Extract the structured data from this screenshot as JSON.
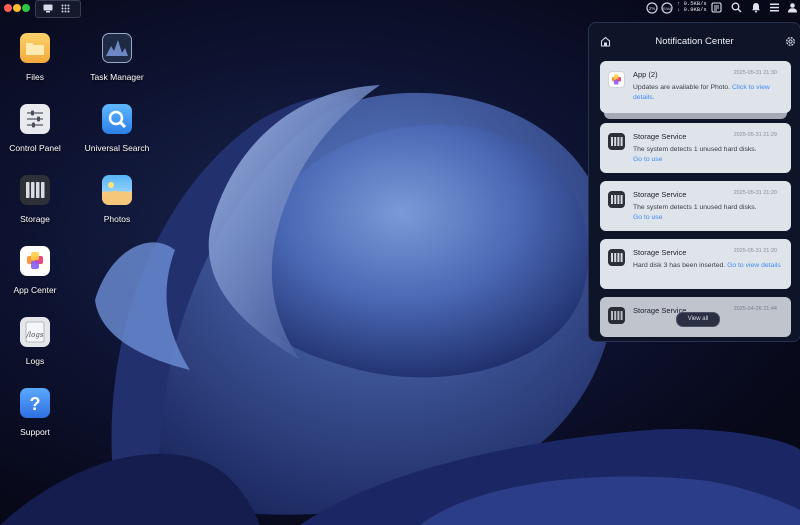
{
  "desktop": {
    "icons": [
      {
        "label": "Files"
      },
      {
        "label": "Task Manager"
      },
      {
        "label": "Control Panel"
      },
      {
        "label": "Universal Search"
      },
      {
        "label": "Storage"
      },
      {
        "label": "Photos"
      },
      {
        "label": "App Center"
      },
      {
        "label": "Logs"
      },
      {
        "label": "Support"
      }
    ]
  },
  "topbar": {
    "network": {
      "up": "↑ 0.5KB/s",
      "down": "↓ 0.9KB/s"
    },
    "disk_label": "2%",
    "ram_label": "RAM"
  },
  "notification_center": {
    "title": "Notification Center",
    "view_all": "View all",
    "items": [
      {
        "title": "App (2)",
        "time": "2025-05-31 21:30",
        "body": "Updates are available for Photo.",
        "link": "Click to view details."
      },
      {
        "title": "Storage Service",
        "time": "2025-05-31 21:29",
        "body": "The system detects 1 unused hard disks.",
        "link": "Go to use"
      },
      {
        "title": "Storage Service",
        "time": "2025-05-31 21:20",
        "body": "The system detects 1 unused hard disks.",
        "link": "Go to use"
      },
      {
        "title": "Storage Service",
        "time": "2025-05-31 21:20",
        "body": "Hard disk 3 has been inserted.",
        "link": "Go to view details"
      },
      {
        "title": "Storage Service",
        "time": "2025-04-26 21:44",
        "body": "",
        "link": ""
      }
    ]
  },
  "colors": {
    "accent_link": "#3f8df2",
    "card_bg": "#dfe3ea",
    "panel_bg": "#0f1528"
  }
}
